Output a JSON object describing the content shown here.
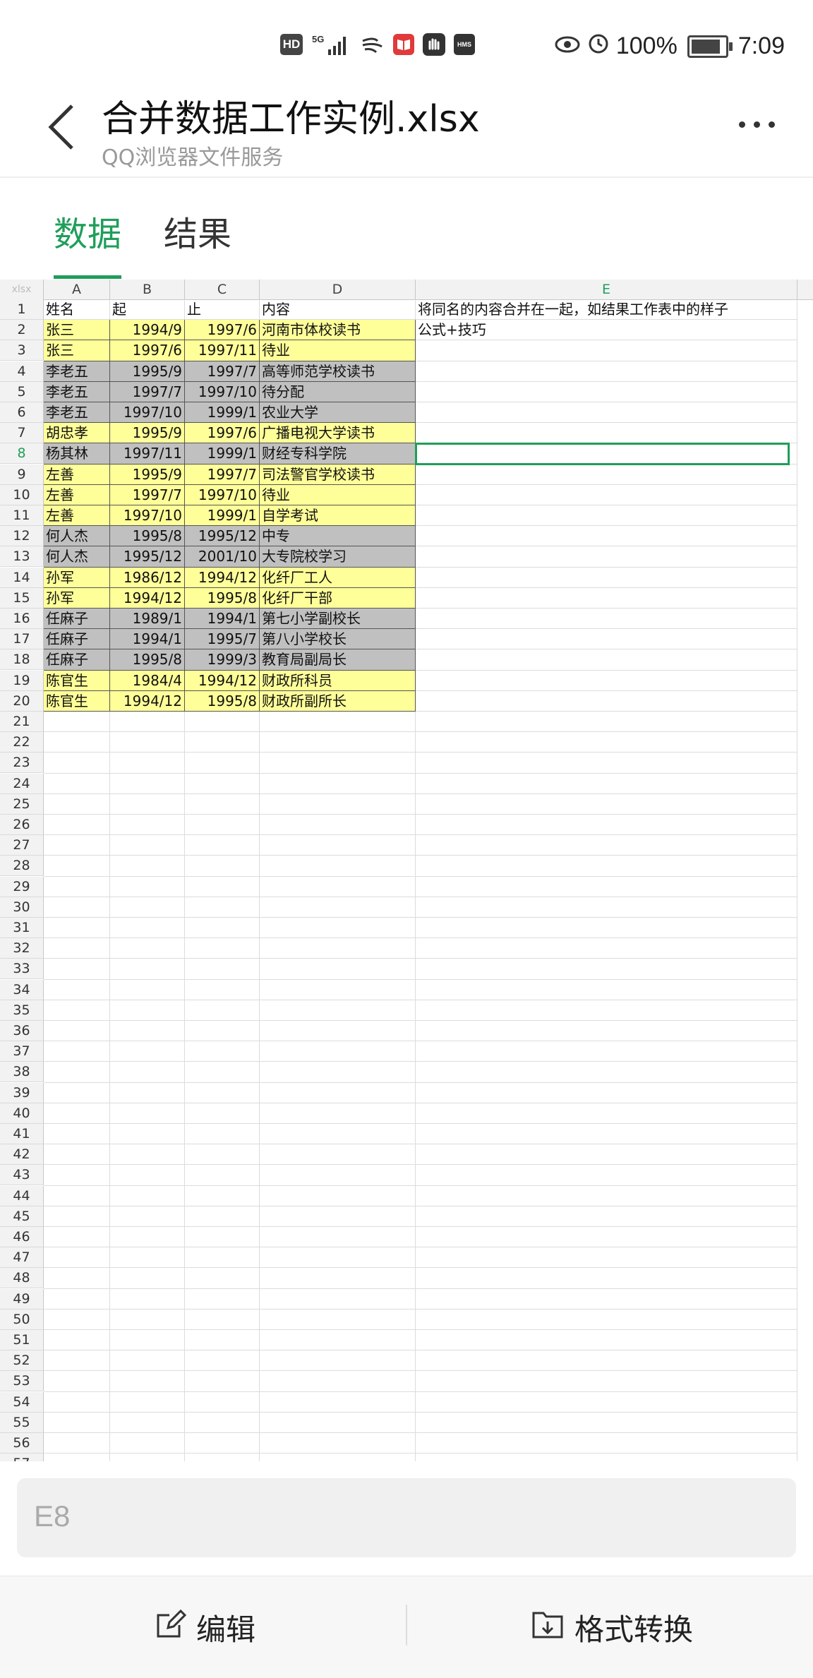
{
  "status_bar": {
    "hd": "HD",
    "network": "5G",
    "hms": "HMS",
    "battery": "100%",
    "time": "7:09"
  },
  "header": {
    "title": "合并数据工作实例.xlsx",
    "subtitle": "QQ浏览器文件服务"
  },
  "tabs": [
    {
      "label": "数据",
      "active": true
    },
    {
      "label": "结果",
      "active": false
    }
  ],
  "sheet": {
    "corner": "xlsx",
    "columns": [
      "A",
      "B",
      "C",
      "D",
      "E"
    ],
    "header_row": [
      "姓名",
      "起",
      "止",
      "内容"
    ],
    "e1": "将同名的内容合并在一起，如结果工作表中的样子",
    "e2": "公式+技巧",
    "rows": [
      {
        "name": "张三",
        "start": "1994/9",
        "end": "1997/6",
        "content": "河南市体校读书",
        "fill": "y"
      },
      {
        "name": "张三",
        "start": "1997/6",
        "end": "1997/11",
        "content": "待业",
        "fill": "y"
      },
      {
        "name": "李老五",
        "start": "1995/9",
        "end": "1997/7",
        "content": "高等师范学校读书",
        "fill": "g"
      },
      {
        "name": "李老五",
        "start": "1997/7",
        "end": "1997/10",
        "content": "待分配",
        "fill": "g"
      },
      {
        "name": "李老五",
        "start": "1997/10",
        "end": "1999/1",
        "content": "农业大学",
        "fill": "g"
      },
      {
        "name": "胡忠孝",
        "start": "1995/9",
        "end": "1997/6",
        "content": "广播电视大学读书",
        "fill": "y"
      },
      {
        "name": "杨其林",
        "start": "1997/11",
        "end": "1999/1",
        "content": "财经专科学院",
        "fill": "g"
      },
      {
        "name": "左善",
        "start": "1995/9",
        "end": "1997/7",
        "content": "司法警官学校读书",
        "fill": "y"
      },
      {
        "name": "左善",
        "start": "1997/7",
        "end": "1997/10",
        "content": "待业",
        "fill": "y"
      },
      {
        "name": "左善",
        "start": "1997/10",
        "end": "1999/1",
        "content": "自学考试",
        "fill": "y"
      },
      {
        "name": "何人杰",
        "start": "1995/8",
        "end": "1995/12",
        "content": "中专",
        "fill": "g"
      },
      {
        "name": "何人杰",
        "start": "1995/12",
        "end": "2001/10",
        "content": "大专院校学习",
        "fill": "g"
      },
      {
        "name": "孙军",
        "start": "1986/12",
        "end": "1994/12",
        "content": "化纤厂工人",
        "fill": "y"
      },
      {
        "name": "孙军",
        "start": "1994/12",
        "end": "1995/8",
        "content": "化纤厂干部",
        "fill": "y"
      },
      {
        "name": "任麻子",
        "start": "1989/1",
        "end": "1994/1",
        "content": "第七小学副校长",
        "fill": "g"
      },
      {
        "name": "任麻子",
        "start": "1994/1",
        "end": "1995/7",
        "content": "第八小学校长",
        "fill": "g"
      },
      {
        "name": "任麻子",
        "start": "1995/8",
        "end": "1999/3",
        "content": "教育局副局长",
        "fill": "g"
      },
      {
        "name": "陈官生",
        "start": "1984/4",
        "end": "1994/12",
        "content": "财政所科员",
        "fill": "y"
      },
      {
        "name": "陈官生",
        "start": "1994/12",
        "end": "1995/8",
        "content": "财政所副所长",
        "fill": "y"
      }
    ],
    "selected_row": 8,
    "visible_row_count": 57
  },
  "name_box": {
    "value": "E8"
  },
  "bottom_bar": {
    "edit_label": "编辑",
    "convert_label": "格式转换"
  }
}
